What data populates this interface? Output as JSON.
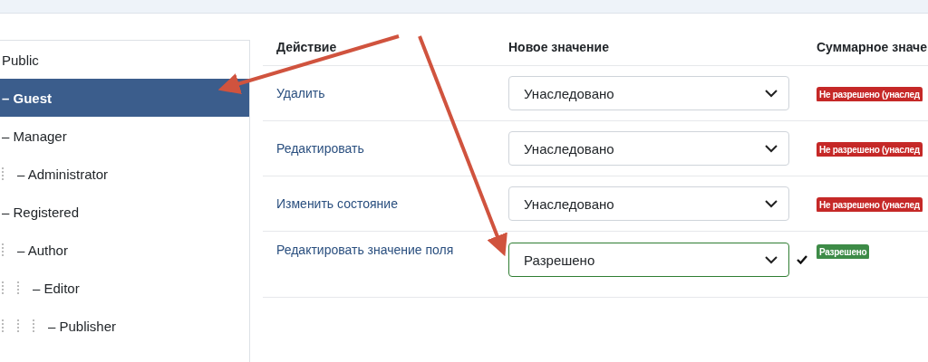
{
  "groups": [
    {
      "label": "Public",
      "selected": false,
      "children": [
        {
          "label": "– Guest",
          "selected": true
        },
        {
          "label": "– Manager",
          "selected": false,
          "children": [
            {
              "label": "– Administrator",
              "selected": false
            }
          ]
        },
        {
          "label": "– Registered",
          "selected": false,
          "children": [
            {
              "label": "– Author",
              "selected": false,
              "children": [
                {
                  "label": "– Editor",
                  "selected": false,
                  "children": [
                    {
                      "label": "– Publisher",
                      "selected": false
                    }
                  ]
                }
              ]
            }
          ]
        }
      ]
    }
  ],
  "table": {
    "columns": [
      "Действие",
      "Новое значение",
      "Суммарное значе"
    ],
    "rows": [
      {
        "action": "Удалить",
        "value": "Унаследовано",
        "changed": false,
        "result": {
          "text": "Не разрешено (унаслед",
          "kind": "denied"
        }
      },
      {
        "action": "Редактировать",
        "value": "Унаследовано",
        "changed": false,
        "result": {
          "text": "Не разрешено (унаслед",
          "kind": "denied"
        }
      },
      {
        "action": "Изменить состояние",
        "value": "Унаследовано",
        "changed": false,
        "result": {
          "text": "Не разрешено (унаслед",
          "kind": "denied"
        }
      },
      {
        "action": "Редактировать значение поля",
        "value": "Разрешено",
        "changed": true,
        "result": {
          "text": "Разрешено",
          "kind": "allowed"
        }
      }
    ]
  }
}
